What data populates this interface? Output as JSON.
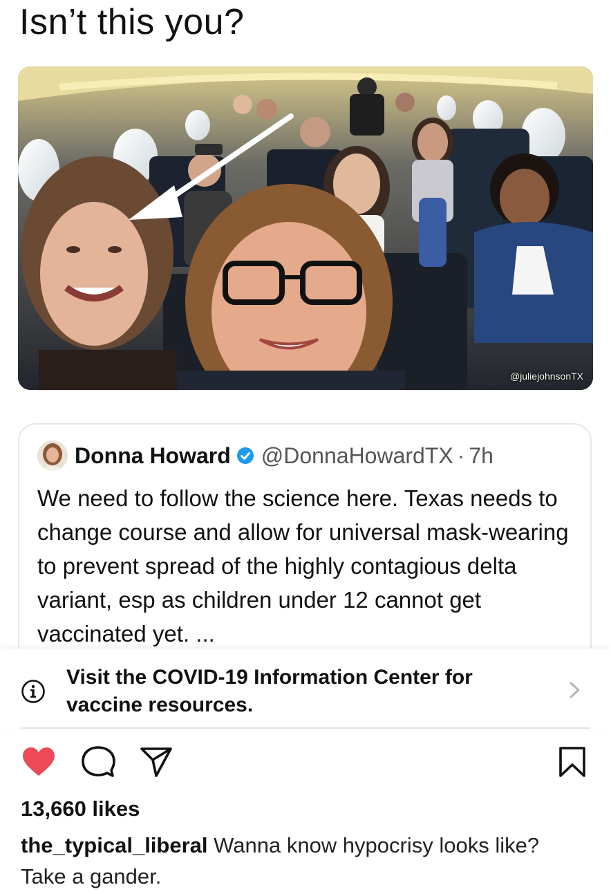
{
  "headline": "Isn’t this you?",
  "photo": {
    "watermark": "@juliejohnsonTX"
  },
  "tweet": {
    "author_name": "Donna Howard",
    "handle": "@DonnaHowardTX",
    "separator": "·",
    "time": "7h",
    "verified": true,
    "text": "We need to follow the science here. Texas needs to change course and allow for universal mask-wearing to prevent spread of the highly contagious delta variant, esp as children under 12 cannot get vaccinated yet. ..."
  },
  "covid_banner": {
    "text": "Visit the COVID-19 Information Center for vaccine resources."
  },
  "actions": {
    "like_icon": "heart-icon",
    "comment_icon": "comment-icon",
    "share_icon": "share-icon",
    "save_icon": "bookmark-icon",
    "liked": true
  },
  "post": {
    "likes": "13,660 likes",
    "username": "the_typical_liberal",
    "caption": "Wanna know hypocrisy looks like? Take a gander."
  },
  "colors": {
    "like_red": "#ed4956",
    "verified_blue": "#1d9bf0"
  }
}
